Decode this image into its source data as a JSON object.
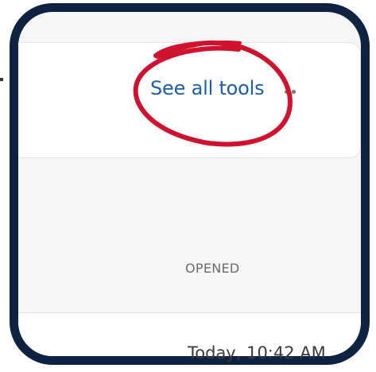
{
  "toolbar": {
    "see_all_tools_label": "See all tools",
    "more_icon": "more-horizontal-icon"
  },
  "list": {
    "column_header": "OPENED",
    "rows": [
      {
        "opened": "Today, 10:42 AM"
      }
    ]
  },
  "colors": {
    "frame_border": "#0d2341",
    "link": "#1a5faa",
    "annotation_circle": "#d0122f"
  }
}
